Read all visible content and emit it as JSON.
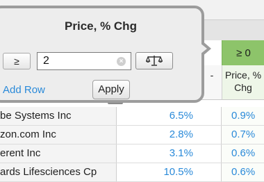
{
  "filter_popup": {
    "title": "Price, % Chg",
    "operator_label": "≥",
    "value": "2",
    "clear_glyph": "×",
    "scale_icon": "balance-scale-icon",
    "add_row_label": "Add Row",
    "apply_label": "Apply"
  },
  "grid": {
    "filter_badge": "≥ 0",
    "col_header_partial": "-",
    "col_header_price_line1": "Price, %",
    "col_header_price_line2": "Chg",
    "rows": [
      {
        "name": "be Systems Inc",
        "v1": "6.5%",
        "v2": "0.9%"
      },
      {
        "name": "zon.com Inc",
        "v1": "2.8%",
        "v2": "0.7%"
      },
      {
        "name": "erent Inc",
        "v1": "3.1%",
        "v2": "0.6%"
      },
      {
        "name": "ards Lifesciences Cp",
        "v1": "10.5%",
        "v2": "0.6%"
      }
    ],
    "handle_glyph": "‹‹",
    "value_color": "#2a8ad9",
    "badge_color": "#8dc46a"
  }
}
